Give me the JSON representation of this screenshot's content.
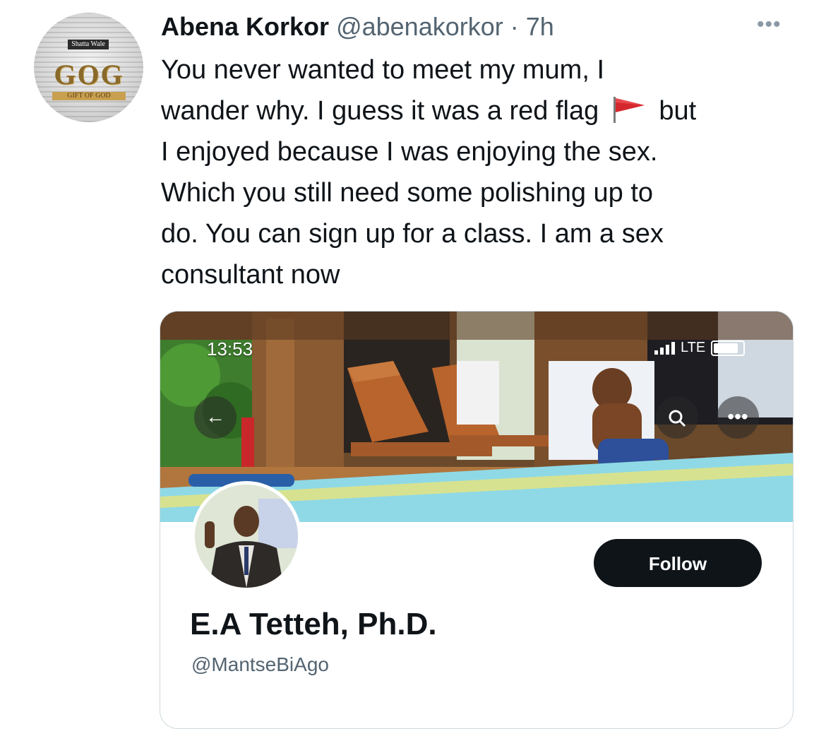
{
  "tweet": {
    "author_name": "Abena Korkor",
    "author_handle": "@abenakorkor",
    "separator": "·",
    "time": "7h",
    "more_icon": "more-horizontal-icon",
    "text_lines": [
      "You never wanted to meet my mum, I",
      "wander why. I guess it was a red flag",
      "but",
      "I enjoyed because I was enjoying the sex.",
      "Which you still need some polishing up to",
      "do. You can sign up for a class. I am a sex",
      "consultant now"
    ],
    "emoji": "red-flag-icon",
    "avatar_brand": "Shatta Wale",
    "avatar_logo": "GOG",
    "avatar_ribbon": "GIFT OF GOD"
  },
  "embedded_profile": {
    "status_time": "13:53",
    "network": "LTE",
    "display_name": "E.A Tetteh, Ph.D.",
    "handle": "@MantseBiAgo",
    "follow_label": "Follow",
    "back_icon": "arrow-left-icon",
    "search_icon": "search-icon",
    "more_icon": "more-horizontal-icon"
  },
  "colors": {
    "text_primary": "#0f1419",
    "text_secondary": "#536471",
    "follow_bg": "#0f1419",
    "border": "#cfd9de"
  }
}
